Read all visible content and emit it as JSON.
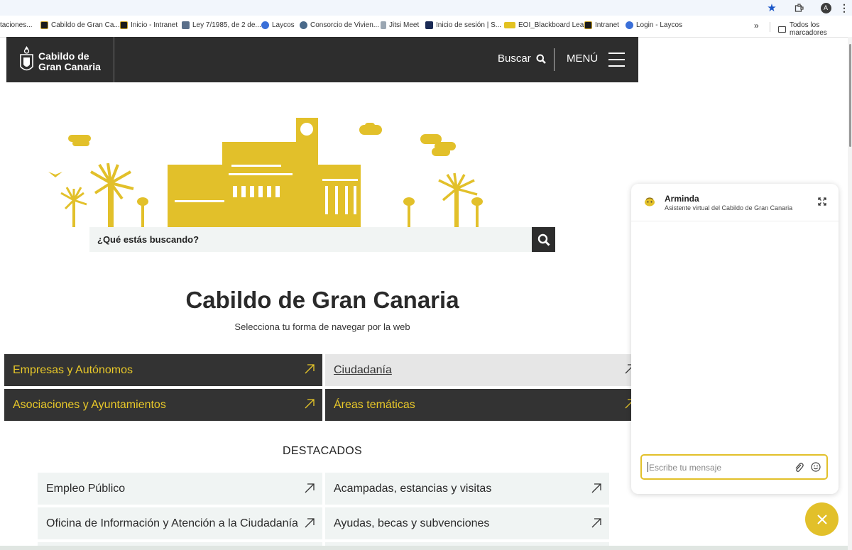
{
  "browser": {
    "bookmarks": [
      {
        "label": "taciones...",
        "icon": "none"
      },
      {
        "label": "Cabildo de Gran Ca...",
        "icon": "cabildo-favicon"
      },
      {
        "label": "Inicio - Intranet",
        "icon": "cabildo-favicon"
      },
      {
        "label": "Ley 7/1985, de 2 de...",
        "icon": "ley-favicon"
      },
      {
        "label": "Laycos",
        "icon": "globe-favicon"
      },
      {
        "label": "Consorcio de Vivien...",
        "icon": "link-favicon"
      },
      {
        "label": "Jitsi Meet",
        "icon": "jitsi-favicon"
      },
      {
        "label": "Inicio de sesión | S...",
        "icon": "check-favicon"
      },
      {
        "label": "EOI_Blackboard Learn",
        "icon": "eoi-favicon"
      },
      {
        "label": "Intranet",
        "icon": "cabildo-favicon"
      },
      {
        "label": "Login - Laycos",
        "icon": "globe-favicon"
      }
    ],
    "more_bookmarks": "»",
    "all_bookmarks": "Todos los marcadores",
    "profile_initial": "A"
  },
  "header": {
    "logo_line1": "Cabildo de",
    "logo_line2": "Gran Canaria",
    "search_label": "Buscar",
    "menu_label": "MENÚ"
  },
  "search": {
    "placeholder": "¿Qué estás buscando?"
  },
  "main": {
    "title": "Cabildo de Gran Canaria",
    "subtitle": "Selecciona tu forma de navegar por la web",
    "tiles": [
      {
        "label": "Empresas y Autónomos"
      },
      {
        "label": "Ciudadanía"
      },
      {
        "label": "Asociaciones y Ayuntamientos"
      },
      {
        "label": "Áreas temáticas"
      }
    ],
    "featured_title": "DESTACADOS",
    "featured": [
      {
        "label": "Empleo Público"
      },
      {
        "label": "Acampadas, estancias y visitas"
      },
      {
        "label": "Oficina de Información y Atención a la Ciudadanía"
      },
      {
        "label": "Ayudas, becas y subvenciones"
      }
    ]
  },
  "chat": {
    "name": "Arminda",
    "subtitle": "Asistente virtual del Cabildo de Gran Canaria",
    "input_placeholder": "Escribe tu mensaje"
  },
  "colors": {
    "brand_yellow": "#e2c02a",
    "header_dark": "#2d2d2d",
    "tile_dark": "#333333"
  }
}
